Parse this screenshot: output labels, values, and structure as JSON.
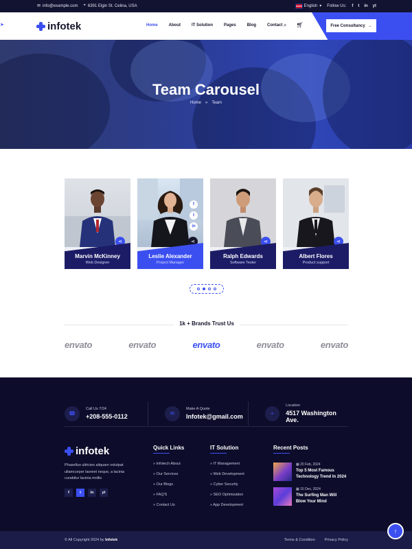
{
  "topbar": {
    "email": "info@example.com",
    "address": "6391 Elgin St. Celina, USA",
    "language": "English",
    "follow_label": "Follow Us:",
    "socials": [
      "f",
      "t",
      "in",
      "yt"
    ]
  },
  "header": {
    "logo_text": "infotek",
    "nav": [
      "Home",
      "About",
      "IT Solution",
      "Pages",
      "Blog",
      "Contact"
    ],
    "active_nav": "Home",
    "cta_label": "Free Consultancy",
    "accent_color": "#3b4ff0"
  },
  "hero": {
    "title": "Team Carousel",
    "breadcrumb": [
      "Home",
      "»",
      "Team"
    ]
  },
  "team": [
    {
      "name": "Marvin McKinney",
      "role": "Web Designer",
      "active": false
    },
    {
      "name": "Leslie Alexander",
      "role": "Project Manager",
      "active": true
    },
    {
      "name": "Ralph Edwards",
      "role": "Software Tester",
      "active": false
    },
    {
      "name": "Albert Flores",
      "role": "Product support",
      "active": false
    }
  ],
  "carousel": {
    "dots": 4,
    "active_dot": 2
  },
  "brands": {
    "title": "1k + Brands Trust Us",
    "logos": [
      "envato",
      "envato",
      "envato",
      "envato",
      "envato"
    ],
    "active_index": 2
  },
  "footer": {
    "contacts": [
      {
        "label": "Call Us 7/24",
        "value": "+208-555-0112",
        "icon": "phone-icon"
      },
      {
        "label": "Make A Quote",
        "value": "Infotek@gmail.com",
        "icon": "mail-icon"
      },
      {
        "label": "Location",
        "value": "4517 Washington Ave.",
        "icon": "location-icon"
      }
    ],
    "logo_text": "infotek",
    "about": "Phasellus ultricies aliquam volutpat ullamcorper laoreet neque, a lacinia curabitur lacinia mollis",
    "socials": [
      "f",
      "t",
      "in",
      "yt"
    ],
    "quick_links_title": "Quick Links",
    "quick_links": [
      "Infotech About",
      "Our Services",
      "Our Blogs",
      "FAQ'S",
      "Contact Us"
    ],
    "it_solution_title": "IT Solution",
    "it_solutions": [
      "IT Management",
      "Web Development",
      "Cyber Security",
      "SEO Optimization",
      "App Development"
    ],
    "recent_posts_title": "Recent Posts",
    "posts": [
      {
        "date": "20 Feb, 2024",
        "title": "Top 5 Most Famous Technology Trend In 2024"
      },
      {
        "date": "15 Dec, 2024",
        "title": "The Surfing Man Will Blow Your Mind"
      }
    ]
  },
  "bottom": {
    "copyright": "© All Copyright 2024 by",
    "brand": "Infotek",
    "links": [
      "Terms & Condition",
      "Privacy Policy"
    ]
  }
}
